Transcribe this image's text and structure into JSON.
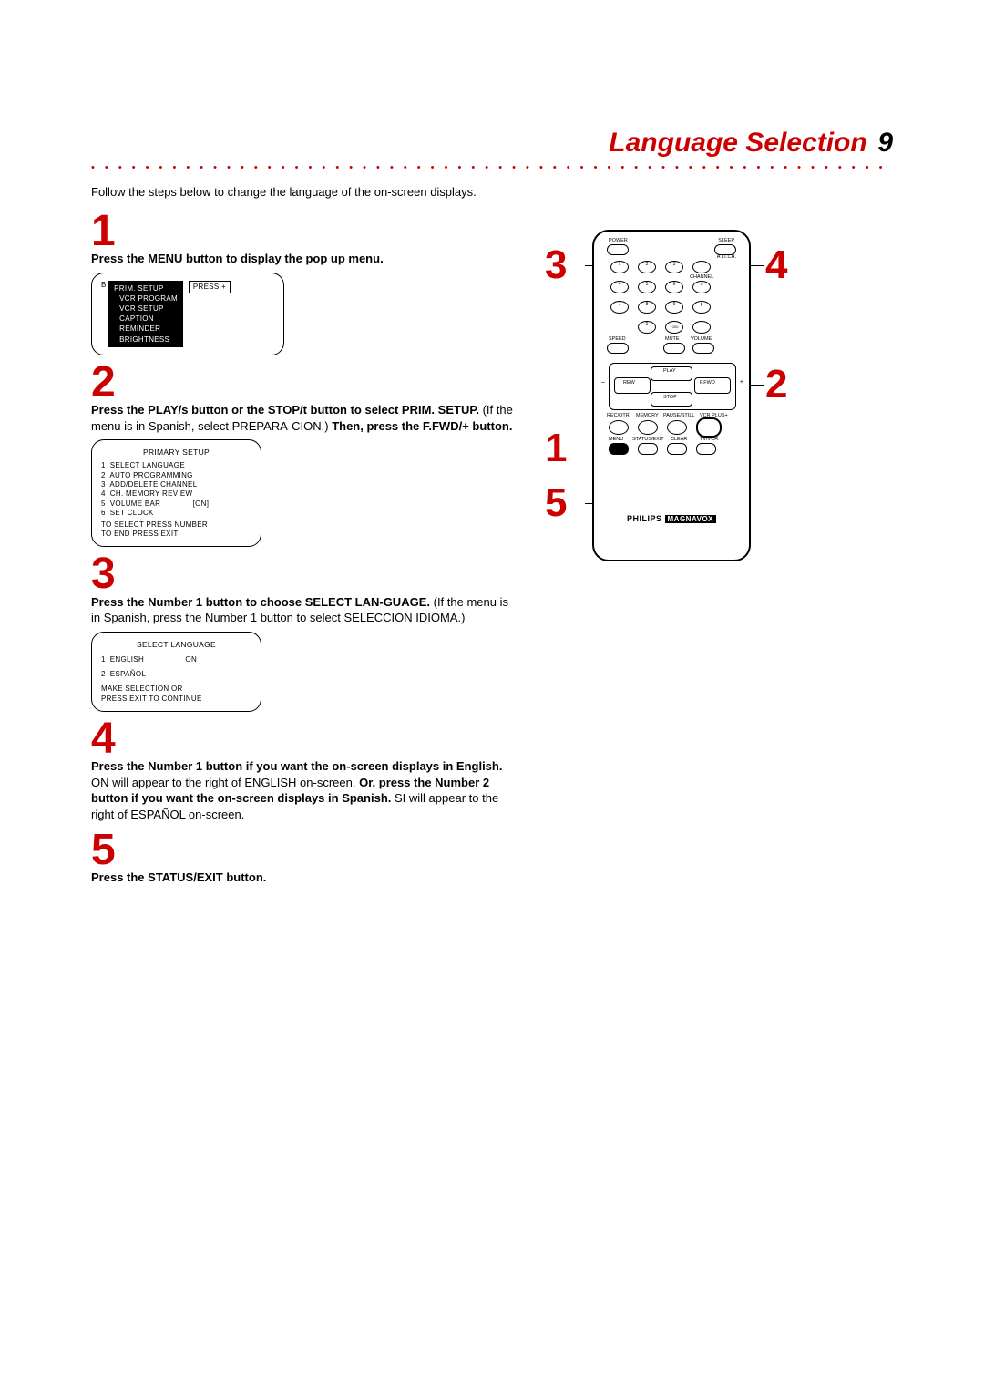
{
  "header": {
    "title": "Language Selection",
    "page_number": "9"
  },
  "intro": "Follow the steps below to change the language of the on-screen displays.",
  "steps": {
    "s1": {
      "num": "1",
      "text_bold": "Press the MENU button to display the pop up menu."
    },
    "s2": {
      "num": "2",
      "lead_bold": "Press the PLAY/s  button or the STOP/t  button to select PRIM. SETUP.",
      "mid": " (If the menu is in Spanish, select PREPARA-CION.) ",
      "trail_bold": "Then, press the F.FWD/+ button."
    },
    "s3": {
      "num": "3",
      "lead_bold": "Press the Number 1 button to choose SELECT LAN-GUAGE.",
      "trail": " (If the menu is in Spanish, press the Number 1 button to select SELECCION IDIOMA.)"
    },
    "s4": {
      "num": "4",
      "a_bold": "Press the Number 1 button if you want the on-screen displays in English.",
      "a_plain": " ON will appear to the right of ENGLISH on-screen. ",
      "b_bold": "Or, press the Number 2 button if you want the on-screen displays in Spanish.",
      "b_plain": " SI will appear to the right of ESPAÑOL on-screen."
    },
    "s5": {
      "num": "5",
      "text_bold": "Press the STATUS/EXIT button."
    }
  },
  "screens": {
    "menu1": {
      "cursor": "B",
      "line1": "PRIM. SETUP",
      "line2": "VCR PROGRAM",
      "line3": "VCR SETUP",
      "line4": "CAPTION",
      "line5": "REMINDER",
      "line6": "BRIGHTNESS",
      "press": "PRESS +"
    },
    "menu2": {
      "title": "PRIMARY SETUP",
      "l1": "1  SELECT LANGUAGE",
      "l2": "2  AUTO PROGRAMMING",
      "l3": "3  ADD/DELETE CHANNEL",
      "l4": "4  CH. MEMORY REVIEW",
      "l5": "5  VOLUME BAR              [ON]",
      "l6": "6  SET CLOCK",
      "f1": "TO SELECT PRESS NUMBER",
      "f2": "TO END PRESS EXIT"
    },
    "menu3": {
      "title": "SELECT LANGUAGE",
      "l1": "1  ENGLISH                  ON",
      "l2": "2  ESPAÑOL",
      "f1": "MAKE SELECTION OR",
      "f2": "PRESS EXIT TO CONTINUE"
    }
  },
  "remote": {
    "labels": {
      "power": "POWER",
      "sleep": "SLEEP",
      "altch": "A LT.CH.",
      "channel": "CHANNEL",
      "speed": "SPEED",
      "mute": "MUTE",
      "volume": "VOLUME",
      "play": "PLAY",
      "rew": "REW",
      "ffwd": "F.FWD",
      "stop": "STOP",
      "recotr": "REC/OTR",
      "memory": "MEMORY",
      "pausestill": "PAUSE/STILL",
      "vcrplus": "VCR PLUS+",
      "menu": "MENU",
      "statusexit": "STATUS/EXIT",
      "clear": "CLEAR",
      "tvvcr": "TV/VCR",
      "minus": "–",
      "plus": "+",
      "n1": "1",
      "n2": "2",
      "n3": "3",
      "n4": "4",
      "n5": "5",
      "n6": "6",
      "n7": "7",
      "n8": "8",
      "n9": "9",
      "n0": "0",
      "n100": "+100",
      "chup": "o",
      "chdn": "p"
    },
    "brand1": "PHILIPS",
    "brand2": "MAGNAVOX",
    "callouts": {
      "c1": "1",
      "c2": "2",
      "c3": "3",
      "c4": "4",
      "c5": "5"
    }
  }
}
